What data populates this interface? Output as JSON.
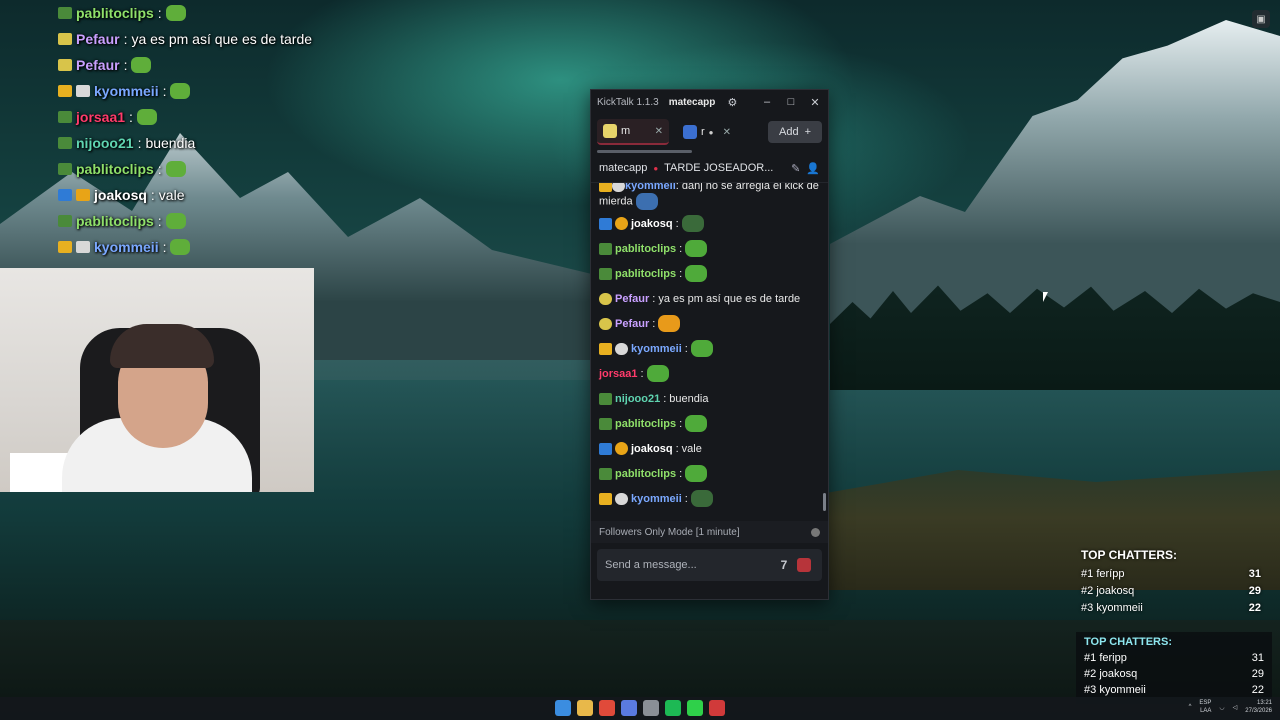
{
  "overlay_chat": [
    {
      "name": "pablitoclips",
      "name_color": "#8fe06a",
      "text": "",
      "emote": true,
      "badges": [
        "#4a8a3a"
      ]
    },
    {
      "name": "Pefaur",
      "name_color": "#c9a0ff",
      "text": "ya es pm así que es de tarde",
      "emote": false,
      "badges": [
        "#d8c44a"
      ]
    },
    {
      "name": "Pefaur",
      "name_color": "#c9a0ff",
      "text": "",
      "emote": true,
      "badges": [
        "#d8c44a"
      ]
    },
    {
      "name": "kyommeii",
      "name_color": "#7aa8ff",
      "text": "",
      "emote": true,
      "badges": [
        "#e8b020",
        "#d8d8d8"
      ]
    },
    {
      "name": "jorsaa1",
      "name_color": "#ff3b6b",
      "text": "",
      "emote": true,
      "badges": [
        "#4a8a3a"
      ]
    },
    {
      "name": "nijooo21",
      "name_color": "#5fd4b0",
      "text": "buendia",
      "emote": false,
      "badges": [
        "#4a8a3a"
      ]
    },
    {
      "name": "pablitoclips",
      "name_color": "#8fe06a",
      "text": "",
      "emote": true,
      "badges": [
        "#4a8a3a"
      ]
    },
    {
      "name": "joakosq",
      "name_color": "#ffffff",
      "text": "vale",
      "emote": false,
      "badges": [
        "#2f7bd6",
        "#e8a417"
      ]
    },
    {
      "name": "pablitoclips",
      "name_color": "#8fe06a",
      "text": "",
      "emote": true,
      "badges": [
        "#4a8a3a"
      ]
    },
    {
      "name": "kyommeii",
      "name_color": "#7aa8ff",
      "text": "",
      "emote": true,
      "badges": [
        "#e8b020",
        "#d8d8d8"
      ]
    }
  ],
  "kicktalk": {
    "app_title": "KickTalk 1.1.3",
    "username": "matecapp",
    "tabs": [
      {
        "label": "m",
        "active": true
      },
      {
        "label": "r",
        "active": false
      }
    ],
    "add_label": "Add",
    "channel": "matecapp",
    "stream_title": "TARDE JOSEADOR...",
    "messages": [
      {
        "badges": [
          "b-gold",
          "b-white"
        ],
        "name": "kyommeii",
        "color": "#7aa8ff",
        "text": "dahj no se arregla el kick de mierda",
        "emote": "blue",
        "wrap": true
      },
      {
        "badges": [
          "b-blue",
          "b-orange"
        ],
        "name": "joakosq",
        "color": "#ffffff",
        "text": "",
        "emote": "dark"
      },
      {
        "badges": [
          "b-green"
        ],
        "name": "pablitoclips",
        "color": "#8fe06a",
        "text": "",
        "emote": "green"
      },
      {
        "badges": [
          "b-green"
        ],
        "name": "pablitoclips",
        "color": "#8fe06a",
        "text": "",
        "emote": "green"
      },
      {
        "badges": [
          "b-yellow"
        ],
        "name": "Pefaur",
        "color": "#c9a0ff",
        "text": "ya es pm así que es de tarde",
        "emote": ""
      },
      {
        "badges": [
          "b-yellow"
        ],
        "name": "Pefaur",
        "color": "#c9a0ff",
        "text": "",
        "emote": "orange"
      },
      {
        "badges": [
          "b-gold",
          "b-white"
        ],
        "name": "kyommeii",
        "color": "#7aa8ff",
        "text": "",
        "emote": "green"
      },
      {
        "badges": [],
        "name": "jorsaa1",
        "color": "#ff3b6b",
        "text": "",
        "emote": "green"
      },
      {
        "badges": [
          "b-green"
        ],
        "name": "nijooo21",
        "color": "#5fd4b0",
        "text": "buendia",
        "emote": ""
      },
      {
        "badges": [
          "b-green"
        ],
        "name": "pablitoclips",
        "color": "#8fe06a",
        "text": "",
        "emote": "green"
      },
      {
        "badges": [
          "b-blue",
          "b-orange"
        ],
        "name": "joakosq",
        "color": "#ffffff",
        "text": "vale",
        "emote": ""
      },
      {
        "badges": [
          "b-green"
        ],
        "name": "pablitoclips",
        "color": "#8fe06a",
        "text": "",
        "emote": "green"
      },
      {
        "badges": [
          "b-gold",
          "b-white"
        ],
        "name": "kyommeii",
        "color": "#7aa8ff",
        "text": "",
        "emote": "dark"
      }
    ],
    "mode_text": "Followers Only Mode [1 minute]",
    "input_placeholder": "Send a message..."
  },
  "top_chatters_1": {
    "title": "TOP CHATTERS:",
    "rows": [
      {
        "rank": "#1",
        "name": "ferípp",
        "count": "31"
      },
      {
        "rank": "#2",
        "name": "joakosq",
        "count": "29"
      },
      {
        "rank": "#3",
        "name": "kyommeii",
        "count": "22"
      }
    ]
  },
  "top_chatters_2": {
    "title": "TOP CHATTERS:",
    "rows": [
      {
        "rank": "#1",
        "name": "feripp",
        "count": "31"
      },
      {
        "rank": "#2",
        "name": "joakosq",
        "count": "29"
      },
      {
        "rank": "#3",
        "name": "kyommeii",
        "count": "22"
      }
    ]
  },
  "taskbar": {
    "icon_colors": [
      "#3b8de0",
      "#e8b84a",
      "#e04a3a",
      "#5a7ae0",
      "#8a8f96",
      "#1db954",
      "#2fd04a",
      "#d03a3a"
    ],
    "lang_top": "ESP",
    "lang_bottom": "LAA",
    "time": "13:21",
    "date": "27/3/2026"
  }
}
